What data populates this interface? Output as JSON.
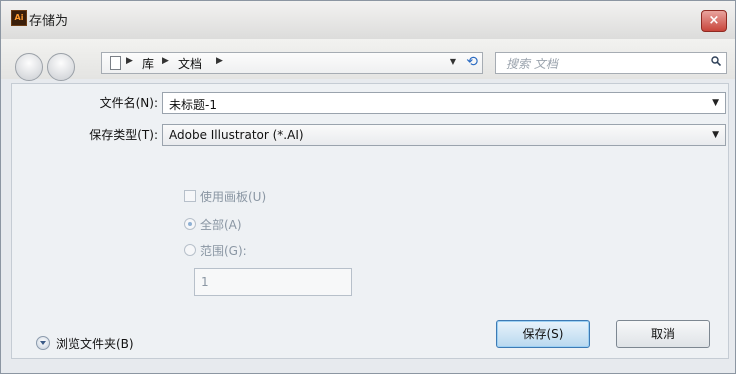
{
  "window": {
    "title": "存储为",
    "app_icon_text": "Ai",
    "close_glyph": "×"
  },
  "nav": {
    "back_icon": "back-arrow-icon",
    "forward_icon": "forward-arrow-icon",
    "breadcrumb": [
      "库",
      "文档"
    ],
    "refresh_glyph": "⟲",
    "search_placeholder": "搜索 文档"
  },
  "form": {
    "filename_label": "文件名(N):",
    "filename_value": "未标题-1",
    "filetype_label": "保存类型(T):",
    "filetype_value": "Adobe Illustrator (*.AI)"
  },
  "options": {
    "use_artboards": "使用画板(U)",
    "all": "全部(A)",
    "range": "范围(G):",
    "range_value": "1"
  },
  "footer": {
    "browse_folders": "浏览文件夹(B)",
    "save_button": "保存(S)",
    "cancel_button": "取消"
  }
}
